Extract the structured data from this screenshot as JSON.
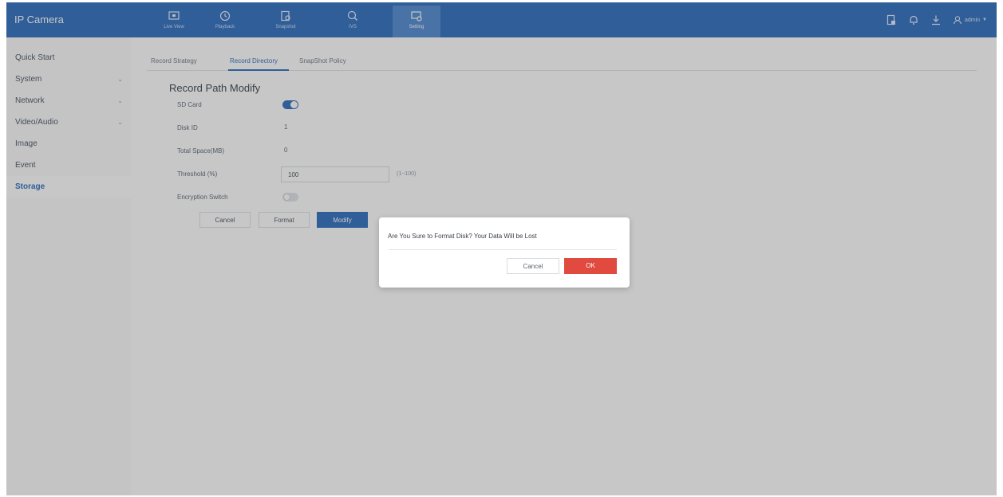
{
  "app": {
    "title": "IP Camera"
  },
  "nav": [
    {
      "label": "Live View",
      "icon": "live-view-icon"
    },
    {
      "label": "Playback",
      "icon": "playback-icon"
    },
    {
      "label": "Snapshot",
      "icon": "snapshot-icon"
    },
    {
      "label": "IVS",
      "icon": "ivs-icon"
    },
    {
      "label": "Setting",
      "icon": "setting-icon",
      "active": true
    }
  ],
  "header": {
    "user": "admin"
  },
  "sidebar": {
    "items": [
      {
        "label": "Quick Start"
      },
      {
        "label": "System",
        "chevron": "⌄"
      },
      {
        "label": "Network",
        "chevron": "⌄"
      },
      {
        "label": "Video/Audio",
        "chevron": "⌄"
      },
      {
        "label": "Image"
      },
      {
        "label": "Event"
      },
      {
        "label": "Storage",
        "active": true
      }
    ]
  },
  "tabs": [
    {
      "label": "Record Strategy"
    },
    {
      "label": "Record Directory",
      "active": true
    },
    {
      "label": "SnapShot Policy"
    }
  ],
  "form": {
    "title": "Record Path Modify",
    "sd_card_label": "SD Card",
    "sd_card_on": true,
    "disk_id_label": "Disk ID",
    "disk_id_value": "1",
    "total_space_label": "Total Space(MB)",
    "total_space_value": "0",
    "threshold_label": "Threshold (%)",
    "threshold_value": "100",
    "threshold_hint": "(1~100)",
    "encryption_label": "Encryption Switch",
    "encryption_on": false,
    "cancel_label": "Cancel",
    "format_label": "Format",
    "modify_label": "Modify"
  },
  "dialog": {
    "message": "Are You Sure to Format Disk? Your Data Will be Lost",
    "cancel_label": "Cancel",
    "ok_label": "OK"
  },
  "colors": {
    "primary": "#3e79c4",
    "danger": "#e04a3f"
  }
}
